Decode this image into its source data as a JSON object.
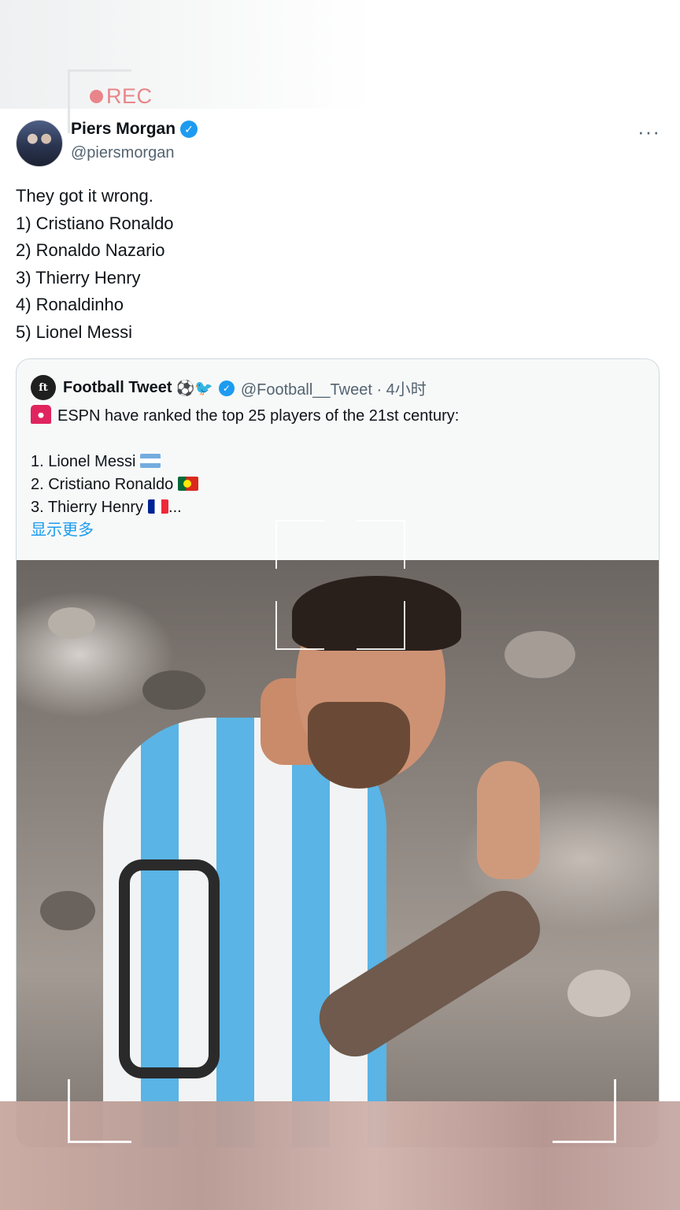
{
  "overlay": {
    "rec_label": "REC"
  },
  "tweet": {
    "author_name": "Piers Morgan",
    "author_handle": "@piersmorgan",
    "more_label": "···",
    "lines": [
      "They got it wrong.",
      "1) Cristiano Ronaldo",
      "2) Ronaldo Nazario",
      "3) Thierry Henry",
      "4) Ronaldinho",
      "5) Lionel Messi"
    ]
  },
  "quote": {
    "avatar_text": "ft",
    "author_name": "Football Tweet",
    "name_emoji": "⚽🐦",
    "author_handle": "@Football__Tweet · 4小时",
    "headline": "ESPN have ranked the top 25 players of the 21st century:",
    "items": [
      {
        "text": "1. Lionel Messi",
        "flag": "argentina"
      },
      {
        "text": "2. Cristiano Ronaldo",
        "flag": "portugal"
      },
      {
        "text": "3. Thierry Henry",
        "flag": "france",
        "suffix": "..."
      }
    ],
    "show_more_label": "显示更多"
  },
  "colors": {
    "link": "#1d9bf0",
    "verified": "#1d9bf0",
    "rec": "#e8858a",
    "secondary_text": "#536471"
  }
}
